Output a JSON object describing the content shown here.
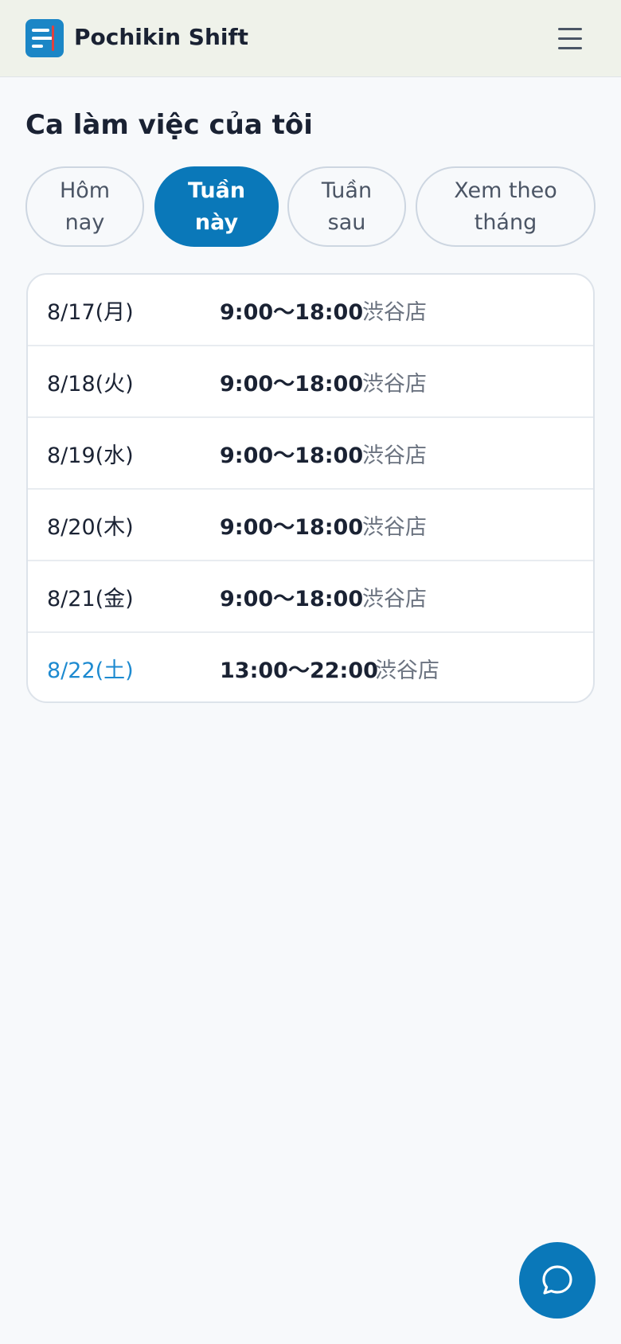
{
  "app": {
    "name": "Pochikin Shift",
    "logo_icon": "app-logo-icon",
    "menu_icon": "hamburger-menu-icon"
  },
  "page": {
    "title": "Ca làm việc của tôi"
  },
  "tabs": [
    {
      "line1": "Hôm",
      "line2": "nay",
      "active": false
    },
    {
      "line1": "Tuần",
      "line2": "này",
      "active": true
    },
    {
      "line1": "Tuần",
      "line2": "sau",
      "active": false
    },
    {
      "line1": "Xem theo",
      "line2": "tháng",
      "active": false
    }
  ],
  "shifts": [
    {
      "date": "8/17(月)",
      "time": "9:00〜18:00",
      "store": "渋谷店"
    },
    {
      "date": "8/18(火)",
      "time": "9:00〜18:00",
      "store": "渋谷店"
    },
    {
      "date": "8/19(水)",
      "time": "9:00〜18:00",
      "store": "渋谷店"
    },
    {
      "date": "8/20(木)",
      "time": "9:00〜18:00",
      "store": "渋谷店"
    },
    {
      "date": "8/21(金)",
      "time": "9:00〜18:00",
      "store": "渋谷店"
    },
    {
      "date": "8/22(土)",
      "time": "13:00〜22:00",
      "store": "渋谷店"
    }
  ],
  "fab": {
    "icon": "chat-bubble-icon"
  },
  "colors": {
    "accent": "#0a78b9",
    "saturday": "#1d8ad0",
    "header_bg": "#eff2ea",
    "page_bg": "#f7f9fb"
  }
}
